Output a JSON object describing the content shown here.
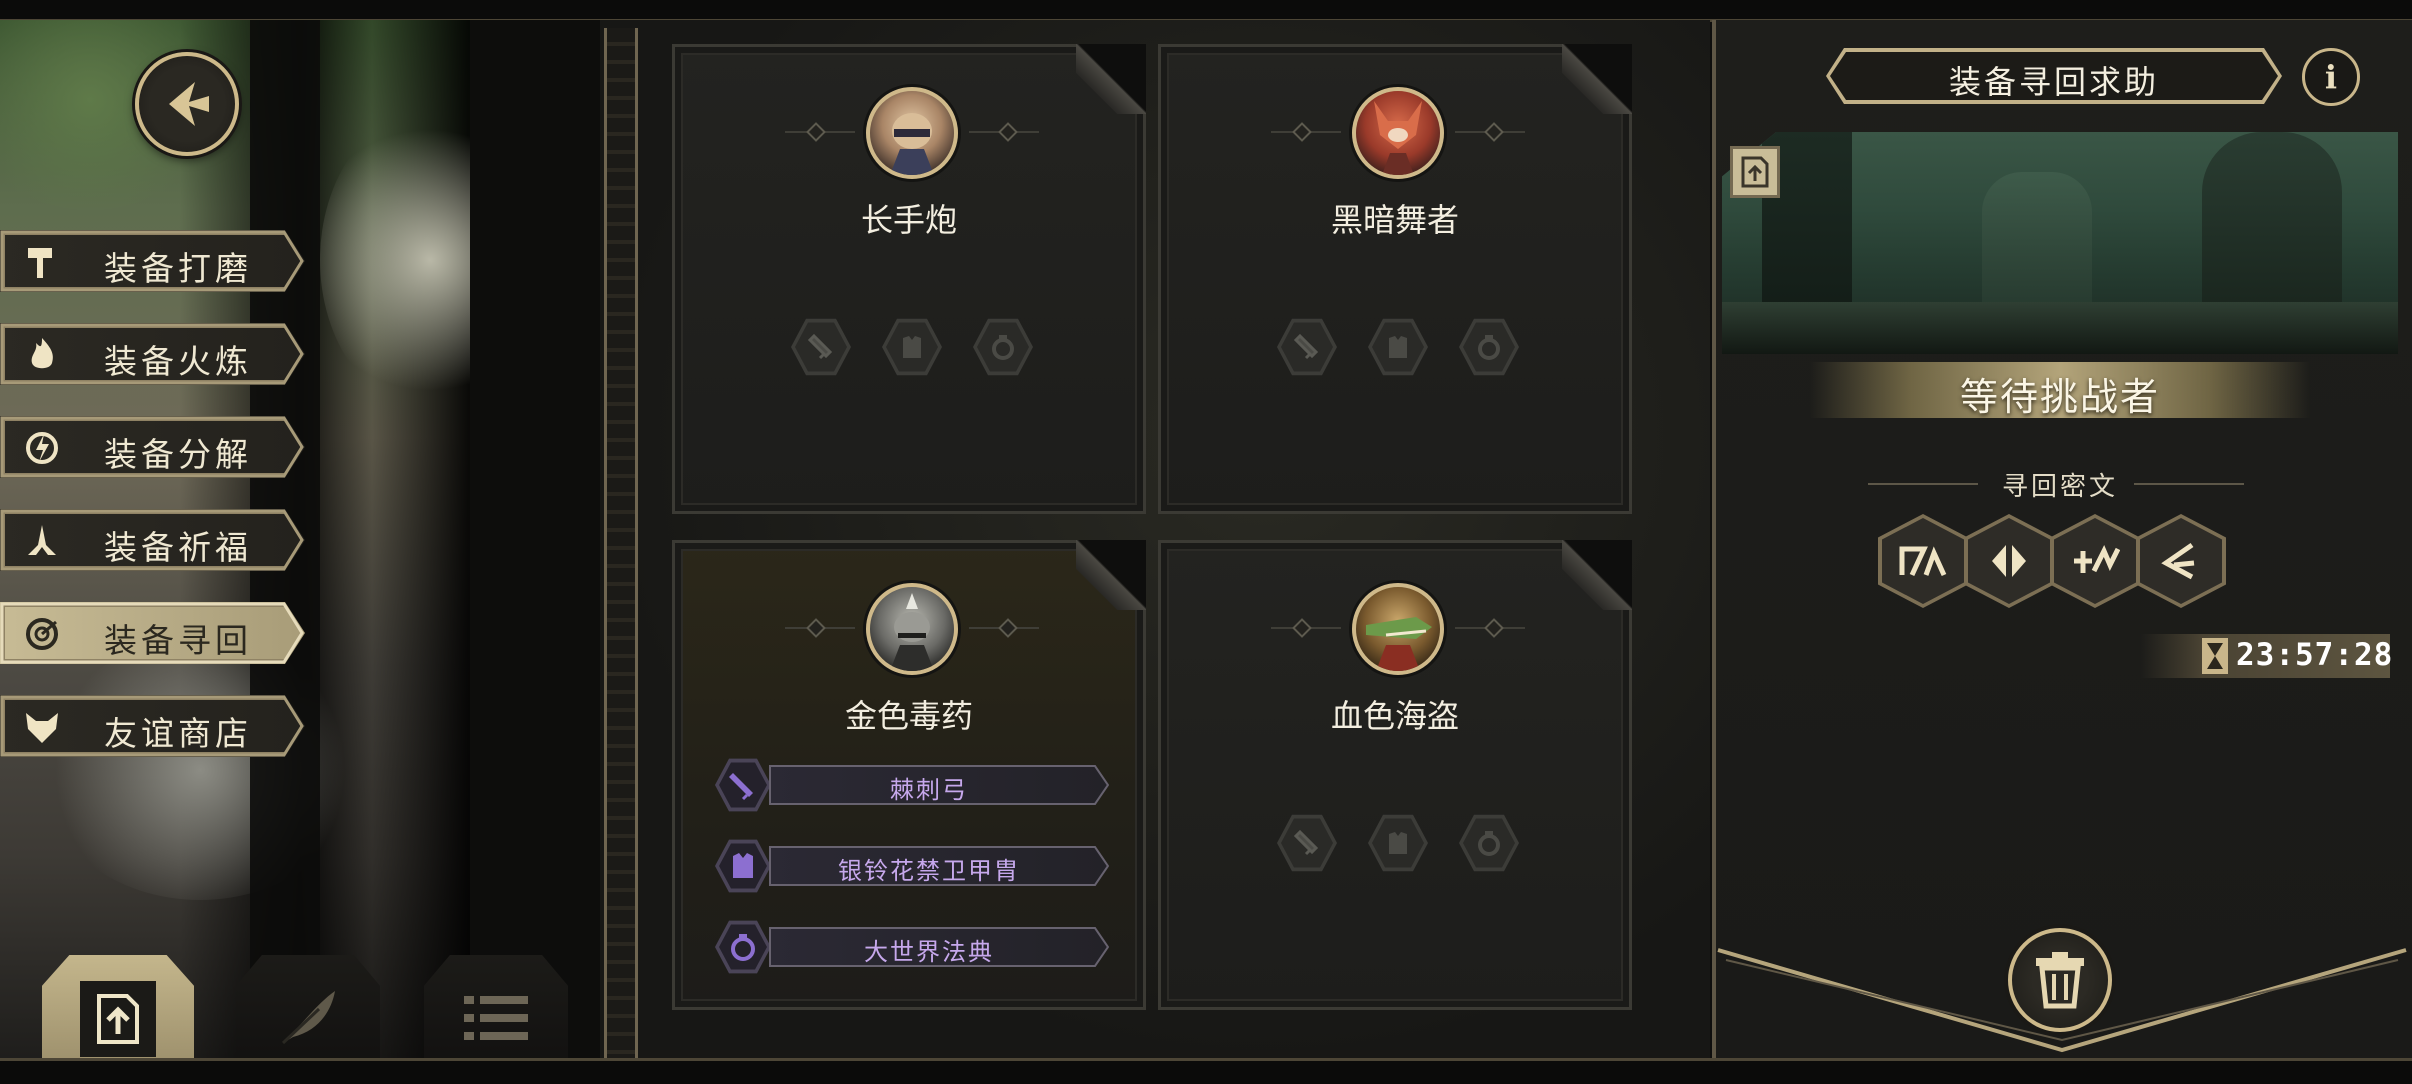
{
  "menu": {
    "items": [
      {
        "label": "装备打磨",
        "icon": "hammer-icon"
      },
      {
        "label": "装备火炼",
        "icon": "flame-icon"
      },
      {
        "label": "装备分解",
        "icon": "disassemble-icon"
      },
      {
        "label": "装备祈福",
        "icon": "pray-hands-icon"
      },
      {
        "label": "装备寻回",
        "icon": "recall-target-icon",
        "active": true
      },
      {
        "label": "友谊商店",
        "icon": "fox-icon"
      }
    ]
  },
  "bottom_tabs": [
    {
      "icon": "upload-doc-icon",
      "active": true
    },
    {
      "icon": "feather-icon",
      "active": false
    },
    {
      "icon": "list-icon",
      "active": false
    }
  ],
  "heroes": [
    {
      "name": "长手炮",
      "portrait": "fox-gunner-portrait",
      "equipment": []
    },
    {
      "name": "黑暗舞者",
      "portrait": "red-fox-dancer-portrait",
      "equipment": []
    },
    {
      "name": "金色毒药",
      "portrait": "lizard-poison-portrait",
      "equipment": [
        {
          "name": "棘刺弓",
          "icon": "sword-icon"
        },
        {
          "name": "银铃花禁卫甲胄",
          "icon": "armor-icon"
        },
        {
          "name": "大世界法典",
          "icon": "ring-icon"
        }
      ]
    },
    {
      "name": "血色海盗",
      "portrait": "crocodile-pirate-portrait",
      "equipment": []
    }
  ],
  "empty_slot_icons": [
    "sword-icon",
    "armor-icon",
    "ring-icon"
  ],
  "help_panel": {
    "title": "装备寻回求助",
    "info_label": "i",
    "status": "等待挑战者",
    "cipher_label": "寻回密文",
    "runes": [
      "rune-1-icon",
      "rune-2-icon",
      "rune-3-icon",
      "rune-4-icon"
    ],
    "timer": "23:57:28"
  },
  "colors": {
    "gold_accent": "#cdb98a",
    "equip_name_purple": "#c6a8ec",
    "panel_bg": "#1e1e1b"
  }
}
